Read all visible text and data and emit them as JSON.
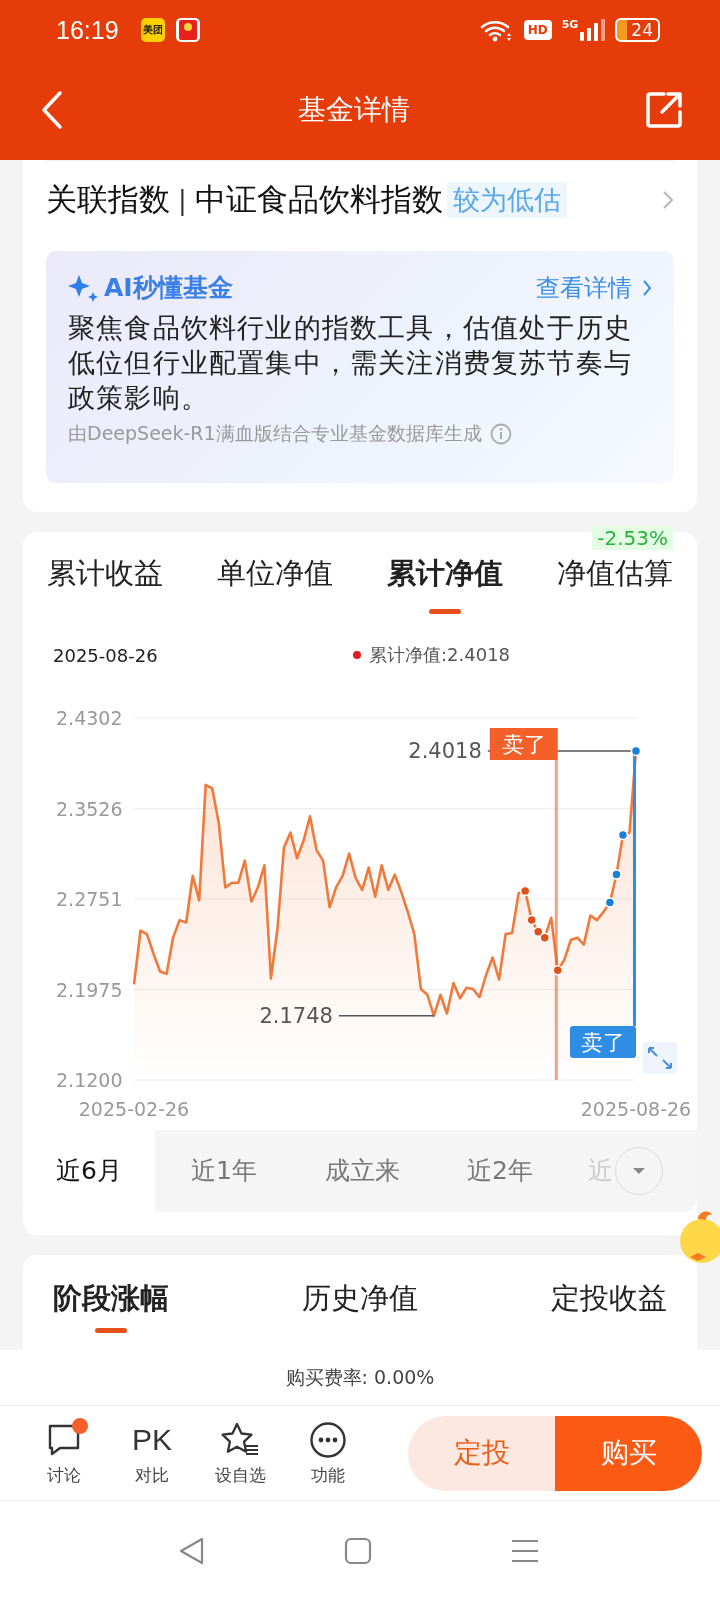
{
  "status_bar": {
    "time": "16:19",
    "notifications": [
      {
        "kind": "meituan",
        "text": "美团"
      },
      {
        "kind": "red-packet"
      }
    ],
    "network": "5G",
    "hd": "HD",
    "battery": "24"
  },
  "nav": {
    "title": "基金详情"
  },
  "index_row": {
    "label": "关联指数",
    "separator": "|",
    "index_name": "中证食品饮料指数",
    "tag": "较为低估"
  },
  "ai_card": {
    "title": "AI秒懂基金",
    "link": "查看详情",
    "body": "聚焦食品饮料行业的指数工具，估值处于历史低位但行业配置集中，需关注消费复苏节奏与政策影响。",
    "source": "由DeepSeek-R1满血版结合专业基金数据库生成"
  },
  "chart_tabs": [
    {
      "label": "累计收益",
      "selected": false
    },
    {
      "label": "单位净值",
      "selected": false
    },
    {
      "label": "累计净值",
      "selected": true
    },
    {
      "label": "净值估算",
      "selected": false,
      "badge": "-2.53%"
    }
  ],
  "chart_header": {
    "date": "2025-08-26",
    "legend": "累计净值:2.4018"
  },
  "chart_data": {
    "type": "area",
    "grid": true,
    "ylim": [
      2.12,
      2.4302
    ],
    "yticks": [
      {
        "value": 2.4302,
        "label": "2.4302"
      },
      {
        "value": 2.3526,
        "label": "2.3526"
      },
      {
        "value": 2.2751,
        "label": "2.2751"
      },
      {
        "value": 2.1975,
        "label": "2.1975"
      },
      {
        "value": 2.12,
        "label": "2.1200"
      }
    ],
    "categories": [
      "2025-02-26",
      null,
      null,
      null,
      null,
      null,
      null,
      null,
      null,
      null,
      null,
      null,
      null,
      null,
      null,
      null,
      null,
      null,
      null,
      null,
      null,
      null,
      null,
      null,
      null,
      null,
      null,
      null,
      null,
      null,
      null,
      null,
      null,
      null,
      null,
      null,
      null,
      null,
      null,
      null,
      null,
      null,
      null,
      null,
      null,
      null,
      null,
      null,
      null,
      null,
      null,
      null,
      null,
      null,
      null,
      null,
      null,
      null,
      null,
      null,
      null,
      null,
      null,
      null,
      null,
      null,
      null,
      null,
      null,
      null,
      null,
      null,
      null,
      null,
      null,
      null,
      null,
      "2025-08-26"
    ],
    "series": [
      {
        "color": "#f07a3c",
        "values": [
          2.202,
          2.248,
          2.245,
          2.228,
          2.213,
          2.211,
          2.242,
          2.257,
          2.255,
          2.295,
          2.274,
          2.373,
          2.37,
          2.34,
          2.285,
          2.289,
          2.289,
          2.308,
          2.273,
          2.285,
          2.304,
          2.207,
          2.249,
          2.319,
          2.332,
          2.31,
          2.325,
          2.346,
          2.317,
          2.308,
          2.268,
          2.285,
          2.295,
          2.314,
          2.293,
          2.283,
          2.302,
          2.277,
          2.304,
          2.283,
          2.296,
          2.281,
          2.264,
          2.245,
          2.198,
          2.193,
          2.175,
          2.193,
          2.177,
          2.203,
          2.19,
          2.199,
          2.198,
          2.191,
          2.21,
          2.225,
          2.206,
          2.245,
          2.246,
          2.28,
          2.282,
          2.257,
          2.247,
          2.242,
          2.259,
          2.214,
          2.223,
          2.24,
          2.242,
          2.236,
          2.261,
          2.257,
          2.264,
          2.272,
          2.296,
          2.33,
          2.332,
          2.402
        ]
      },
      {
        "type": "scatter",
        "color": "#e0501a",
        "values": [
          null,
          null,
          null,
          null,
          null,
          null,
          null,
          null,
          null,
          null,
          null,
          null,
          null,
          null,
          null,
          null,
          null,
          null,
          null,
          null,
          null,
          null,
          null,
          null,
          null,
          null,
          null,
          null,
          null,
          null,
          null,
          null,
          null,
          null,
          null,
          null,
          null,
          null,
          null,
          null,
          null,
          null,
          null,
          null,
          null,
          null,
          null,
          null,
          null,
          null,
          null,
          null,
          null,
          null,
          null,
          null,
          null,
          null,
          null,
          null,
          2.282,
          2.257,
          2.247,
          2.242,
          null,
          2.214,
          null,
          null,
          null,
          null,
          null,
          null,
          null,
          null,
          null,
          null,
          null,
          null
        ]
      },
      {
        "type": "scatter",
        "color": "#1a7fd8",
        "values": [
          null,
          null,
          null,
          null,
          null,
          null,
          null,
          null,
          null,
          null,
          null,
          null,
          null,
          null,
          null,
          null,
          null,
          null,
          null,
          null,
          null,
          null,
          null,
          null,
          null,
          null,
          null,
          null,
          null,
          null,
          null,
          null,
          null,
          null,
          null,
          null,
          null,
          null,
          null,
          null,
          null,
          null,
          null,
          null,
          null,
          null,
          null,
          null,
          null,
          null,
          null,
          null,
          null,
          null,
          null,
          null,
          null,
          null,
          null,
          null,
          null,
          null,
          null,
          null,
          null,
          null,
          null,
          null,
          null,
          null,
          null,
          null,
          null,
          2.272,
          2.296,
          2.33,
          null,
          2.402
        ]
      }
    ],
    "annotations": [
      "2.4018",
      "2.1748",
      "卖了",
      "卖了"
    ]
  },
  "periods": [
    {
      "label": "近6月",
      "selected": true
    },
    {
      "label": "近1年",
      "selected": false
    },
    {
      "label": "成立来",
      "selected": false
    },
    {
      "label": "近2年",
      "selected": false
    },
    {
      "label": "近",
      "selected": false
    }
  ],
  "detail_tabs": [
    {
      "label": "阶段涨幅",
      "selected": true
    },
    {
      "label": "历史净值",
      "selected": false
    },
    {
      "label": "定投收益",
      "selected": false
    }
  ],
  "fee": "购买费率: 0.00%",
  "toolbar": [
    {
      "label": "讨论",
      "kind": "chat",
      "dot": true
    },
    {
      "label": "对比",
      "kind": "text",
      "glyph": "PK",
      "dot": false
    },
    {
      "label": "设自选",
      "kind": "star",
      "dot": false
    },
    {
      "label": "功能",
      "kind": "more",
      "dot": false
    }
  ],
  "actions": [
    {
      "label": "定投",
      "kind": "secondary"
    },
    {
      "label": "购买",
      "kind": "primary"
    }
  ]
}
